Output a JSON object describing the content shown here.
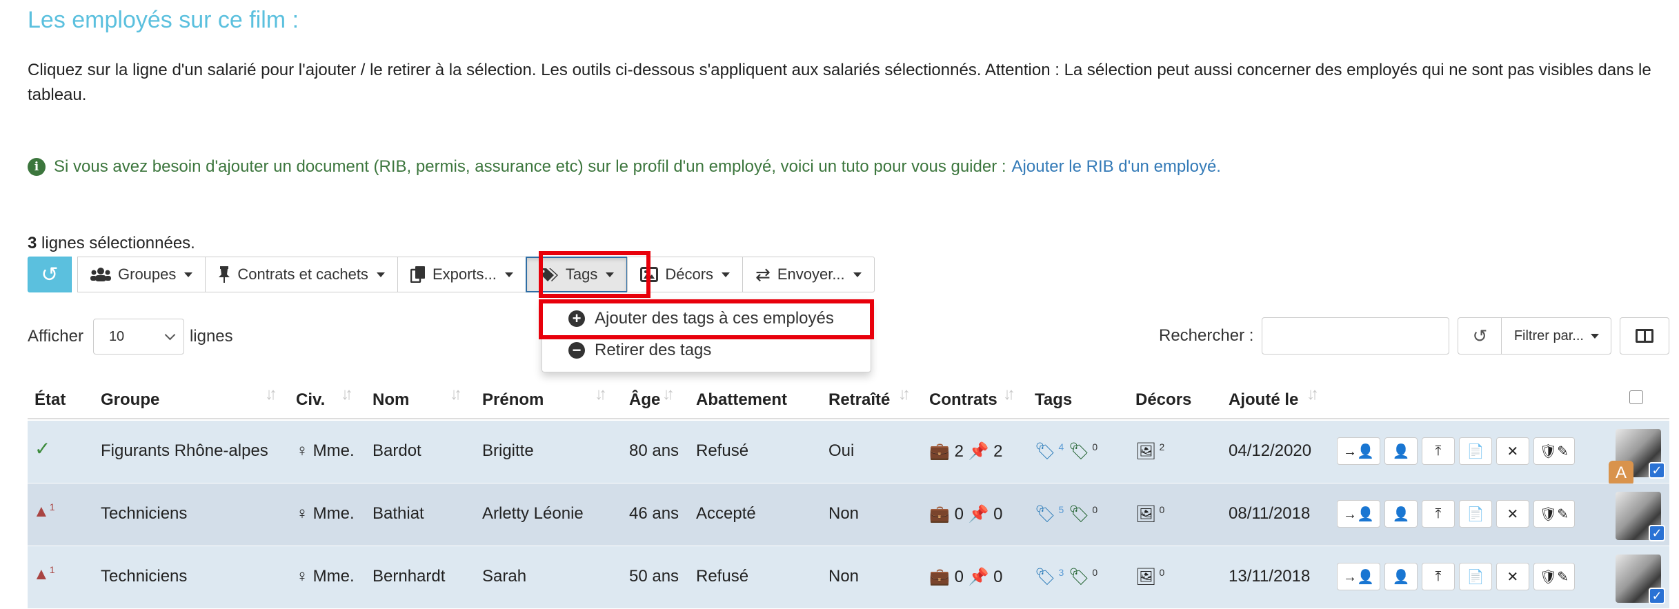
{
  "page": {
    "title": "Les employés sur ce film :",
    "intro": "Cliquez sur la ligne d'un salarié pour l'ajouter / le retirer à la sélection. Les outils ci-dessous s'appliquent aux salariés sélectionnés. Attention : La sélection peut aussi concerner des employés qui ne sont pas visibles dans le tableau.",
    "info_text": "Si vous avez besoin d'ajouter un document (RIB, permis, assurance etc) sur le profil d'un employé, voici un tuto pour vous guider :",
    "info_link": "Ajouter le RIB d'un employé.",
    "selected_count": "3",
    "selected_label": "lignes sélectionnées."
  },
  "toolbar": {
    "groupes": "Groupes",
    "contrats": "Contrats et cachets",
    "exports": "Exports...",
    "tags": "Tags",
    "decors": "Décors",
    "envoyer": "Envoyer..."
  },
  "tags_menu": {
    "add": "Ajouter des tags à ces employés",
    "remove": "Retirer des tags"
  },
  "table_controls": {
    "show_label": "Afficher",
    "page_size": "10",
    "rows_label": "lignes",
    "search_label": "Rechercher :",
    "search_value": "",
    "filter_label": "Filtrer par..."
  },
  "columns": {
    "etat": "État",
    "groupe": "Groupe",
    "civ": "Civ.",
    "nom": "Nom",
    "prenom": "Prénom",
    "age": "Âge",
    "abattement": "Abattement",
    "retraite": "Retraîté",
    "contrats": "Contrats",
    "tags": "Tags",
    "decors": "Décors",
    "ajoute": "Ajouté le"
  },
  "rows": [
    {
      "etat_count": "",
      "groupe": "Figurants Rhône-alpes",
      "civ": "Mme.",
      "nom": "Bardot",
      "prenom": "Brigitte",
      "age": "80 ans",
      "abattement": "Refusé",
      "retraite": "Oui",
      "contrats": "2",
      "cachets": "2",
      "tags_blue": "4",
      "tags_green": "0",
      "decors": "2",
      "ajoute": "04/12/2020",
      "badge": "A"
    },
    {
      "etat_count": "1",
      "groupe": "Techniciens",
      "civ": "Mme.",
      "nom": "Bathiat",
      "prenom": "Arletty Léonie",
      "age": "46 ans",
      "abattement": "Accepté",
      "retraite": "Non",
      "contrats": "0",
      "cachets": "0",
      "tags_blue": "5",
      "tags_green": "0",
      "decors": "0",
      "ajoute": "08/11/2018",
      "badge": ""
    },
    {
      "etat_count": "1",
      "groupe": "Techniciens",
      "civ": "Mme.",
      "nom": "Bernhardt",
      "prenom": "Sarah",
      "age": "50 ans",
      "abattement": "Refusé",
      "retraite": "Non",
      "contrats": "0",
      "cachets": "0",
      "tags_blue": "3",
      "tags_green": "0",
      "decors": "0",
      "ajoute": "13/11/2018",
      "badge": ""
    }
  ],
  "icons": {
    "reset": "undo-icon",
    "groupes": "users-icon",
    "contrats": "pin-icon",
    "exports": "copy-icon",
    "tags": "tags-icon",
    "decors": "image-icon",
    "envoyer": "exchange-icon",
    "add": "plus-circle-icon",
    "remove": "minus-circle-icon",
    "info": "info-icon"
  },
  "colors": {
    "accent": "#5bc0de",
    "highlight": "#e8000b",
    "info": "#3c763d",
    "link": "#337ab7",
    "row_odd": "#dde8f1",
    "row_even": "#d3dee9"
  }
}
